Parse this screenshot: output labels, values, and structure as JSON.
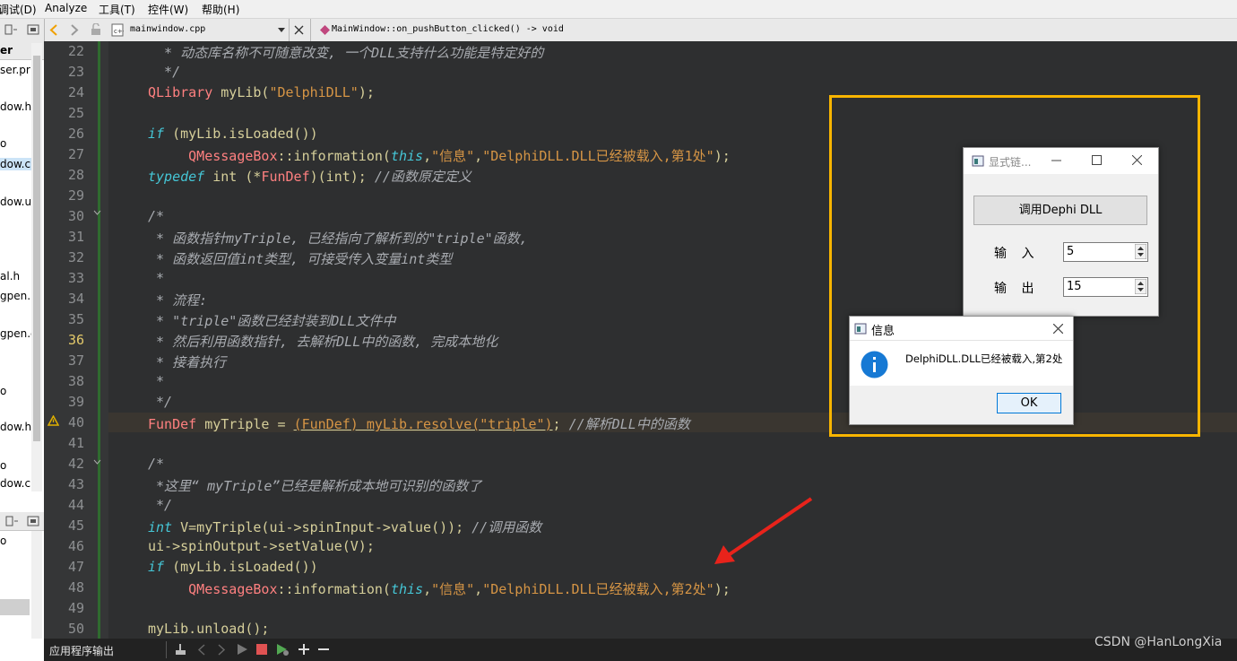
{
  "menu": [
    "调试(D)",
    "Analyze",
    "工具(T)",
    "控件(W)",
    "帮助(H)"
  ],
  "editor_toolbar": {
    "file_name": "mainwindow.cpp",
    "function_name": "MainWindow::on_pushButton_clicked() -> void"
  },
  "left_panel": {
    "header": "er",
    "files": [
      "ser.pr",
      "dow.h",
      "o",
      "dow.c",
      "dow.u",
      "al.h",
      "gpen.h",
      "gpen.c",
      "o",
      "dow.h",
      "o",
      "dow.c",
      "o"
    ]
  },
  "code_lines": [
    {
      "n": "22",
      "segs": [
        {
          "c": "cmt",
          "t": "  * 动态库名称不可随意改变, 一个DLL支持什么功能是特定好的"
        }
      ]
    },
    {
      "n": "23",
      "segs": [
        {
          "c": "cmt",
          "t": "  */"
        }
      ]
    },
    {
      "n": "24",
      "segs": [
        {
          "c": "typ",
          "t": "QLibrary"
        },
        {
          "c": "plain",
          "t": " myLib("
        },
        {
          "c": "str",
          "t": "\"DelphiDLL\""
        },
        {
          "c": "plain",
          "t": ");"
        }
      ]
    },
    {
      "n": "25",
      "segs": []
    },
    {
      "n": "26",
      "segs": [
        {
          "c": "kw",
          "t": "if"
        },
        {
          "c": "plain",
          "t": " (myLib.isLoaded())"
        }
      ]
    },
    {
      "n": "27",
      "segs": [
        {
          "c": "plain",
          "t": "     "
        },
        {
          "c": "typ",
          "t": "QMessageBox"
        },
        {
          "c": "plain",
          "t": "::information("
        },
        {
          "c": "kw",
          "t": "this"
        },
        {
          "c": "plain",
          "t": ","
        },
        {
          "c": "str",
          "t": "\"信息\""
        },
        {
          "c": "plain",
          "t": ","
        },
        {
          "c": "str",
          "t": "\"DelphiDLL.DLL已经被载入,第1处\""
        },
        {
          "c": "plain",
          "t": ");"
        }
      ]
    },
    {
      "n": "28",
      "segs": [
        {
          "c": "kw",
          "t": "typedef"
        },
        {
          "c": "plain",
          "t": " int (*"
        },
        {
          "c": "typ",
          "t": "FunDef"
        },
        {
          "c": "plain",
          "t": ")(int); "
        },
        {
          "c": "cmt",
          "t": "//函数原定定义"
        }
      ]
    },
    {
      "n": "29",
      "segs": []
    },
    {
      "n": "30",
      "segs": [
        {
          "c": "cmt",
          "t": "/*"
        }
      ]
    },
    {
      "n": "31",
      "segs": [
        {
          "c": "cmt",
          "t": " * 函数指针myTriple, 已经指向了解析到的\"triple\"函数,"
        }
      ]
    },
    {
      "n": "32",
      "segs": [
        {
          "c": "cmt",
          "t": " * 函数返回值int类型, 可接受传入变量int类型"
        }
      ]
    },
    {
      "n": "33",
      "segs": [
        {
          "c": "cmt",
          "t": " *"
        }
      ]
    },
    {
      "n": "34",
      "segs": [
        {
          "c": "cmt",
          "t": " * 流程:"
        }
      ]
    },
    {
      "n": "35",
      "segs": [
        {
          "c": "cmt",
          "t": " * \"triple\"函数已经封装到DLL文件中"
        }
      ]
    },
    {
      "n": "36",
      "segs": [
        {
          "c": "cmt",
          "t": " * 然后利用函数指针, 去解析DLL中的函数, 完成本地化"
        }
      ]
    },
    {
      "n": "37",
      "segs": [
        {
          "c": "cmt",
          "t": " * 接着执行"
        }
      ]
    },
    {
      "n": "38",
      "segs": [
        {
          "c": "cmt",
          "t": " *"
        }
      ]
    },
    {
      "n": "39",
      "segs": [
        {
          "c": "cmt",
          "t": " */"
        }
      ]
    },
    {
      "n": "40",
      "segs": [
        {
          "c": "typ",
          "t": "FunDef"
        },
        {
          "c": "plain",
          "t": " myTriple = "
        },
        {
          "c": "str",
          "t": "(FunDef) myLib.resolve(\"triple\")"
        },
        {
          "c": "plain",
          "t": "; "
        },
        {
          "c": "cmt",
          "t": "//解析DLL中的函数"
        }
      ]
    },
    {
      "n": "41",
      "segs": []
    },
    {
      "n": "42",
      "segs": [
        {
          "c": "cmt",
          "t": "/*"
        }
      ]
    },
    {
      "n": "43",
      "segs": [
        {
          "c": "cmt",
          "t": " *这里“ myTriple”已经是解析成本地可识别的函数了"
        }
      ]
    },
    {
      "n": "44",
      "segs": [
        {
          "c": "cmt",
          "t": " */"
        }
      ]
    },
    {
      "n": "45",
      "segs": [
        {
          "c": "kw",
          "t": "int"
        },
        {
          "c": "plain",
          "t": " V=myTriple(ui->spinInput->value()); "
        },
        {
          "c": "cmt",
          "t": "//调用函数"
        }
      ]
    },
    {
      "n": "46",
      "segs": [
        {
          "c": "plain",
          "t": "ui->spinOutput->setValue(V);"
        }
      ]
    },
    {
      "n": "47",
      "segs": [
        {
          "c": "kw",
          "t": "if"
        },
        {
          "c": "plain",
          "t": " (myLib.isLoaded())"
        }
      ]
    },
    {
      "n": "48",
      "segs": [
        {
          "c": "plain",
          "t": "     "
        },
        {
          "c": "typ",
          "t": "QMessageBox"
        },
        {
          "c": "plain",
          "t": "::information("
        },
        {
          "c": "kw",
          "t": "this"
        },
        {
          "c": "plain",
          "t": ","
        },
        {
          "c": "str",
          "t": "\"信息\""
        },
        {
          "c": "plain",
          "t": ","
        },
        {
          "c": "str",
          "t": "\"DelphiDLL.DLL已经被载入,第2处\""
        },
        {
          "c": "plain",
          "t": ");"
        }
      ]
    },
    {
      "n": "49",
      "segs": []
    },
    {
      "n": "50",
      "segs": [
        {
          "c": "plain",
          "t": "myLib.unload();"
        }
      ]
    }
  ],
  "bottom_bar": {
    "output_label": "应用程序输出"
  },
  "app_window": {
    "title": "显式链...",
    "button_label": "调用Dephi DLL",
    "input_label": "输 入",
    "input_value": "5",
    "output_label": "输 出",
    "output_value": "15"
  },
  "message_box": {
    "title": "信息",
    "message": "DelphiDLL.DLL已经被载入,第2处",
    "ok_label": "OK"
  },
  "watermark": "CSDN @HanLongXia",
  "colors": {
    "highlight_border": "#f8b500",
    "arrow": "#e8231b",
    "info_icon": "#1679d4"
  }
}
